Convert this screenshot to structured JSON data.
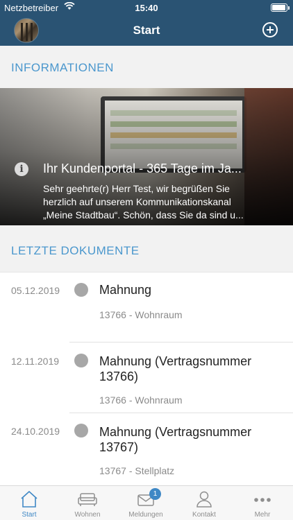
{
  "status_bar": {
    "carrier": "Netzbetreiber",
    "time": "15:40"
  },
  "header": {
    "title": "Start"
  },
  "sections": {
    "info": "INFORMATIONEN",
    "docs": "LETZTE DOKUMENTE"
  },
  "info_card": {
    "title": "Ihr Kundenportal - 365 Tage im Ja...",
    "text_lines": [
      "Sehr geehrte(r) Herr Test, wir begrüßen Sie",
      "herzlich auf unserem Kommunikationskanal",
      "„Meine Stadtbau“. Schön, dass Sie da sind u..."
    ]
  },
  "documents": [
    {
      "date": "05.12.2019",
      "title_lines": [
        "Mahnung"
      ],
      "subtitle": "13766 - Wohnraum"
    },
    {
      "date": "12.11.2019",
      "title_lines": [
        "Mahnung (Vertragsnummer",
        "13766)"
      ],
      "subtitle": "13766 - Wohnraum"
    },
    {
      "date": "24.10.2019",
      "title_lines": [
        "Mahnung (Vertragsnummer",
        "13767)"
      ],
      "subtitle": "13767 - Stellplatz"
    }
  ],
  "tabs": [
    {
      "label": "Start",
      "icon": "home-icon",
      "active": true
    },
    {
      "label": "Wohnen",
      "icon": "sofa-icon",
      "active": false
    },
    {
      "label": "Meldungen",
      "icon": "mail-icon",
      "active": false,
      "badge": "1"
    },
    {
      "label": "Kontakt",
      "icon": "person-icon",
      "active": false
    },
    {
      "label": "Mehr",
      "icon": "more-icon",
      "active": false
    }
  ],
  "colors": {
    "header": "#2a5373",
    "accent": "#4a97cd",
    "tab_active": "#3f88c5"
  }
}
